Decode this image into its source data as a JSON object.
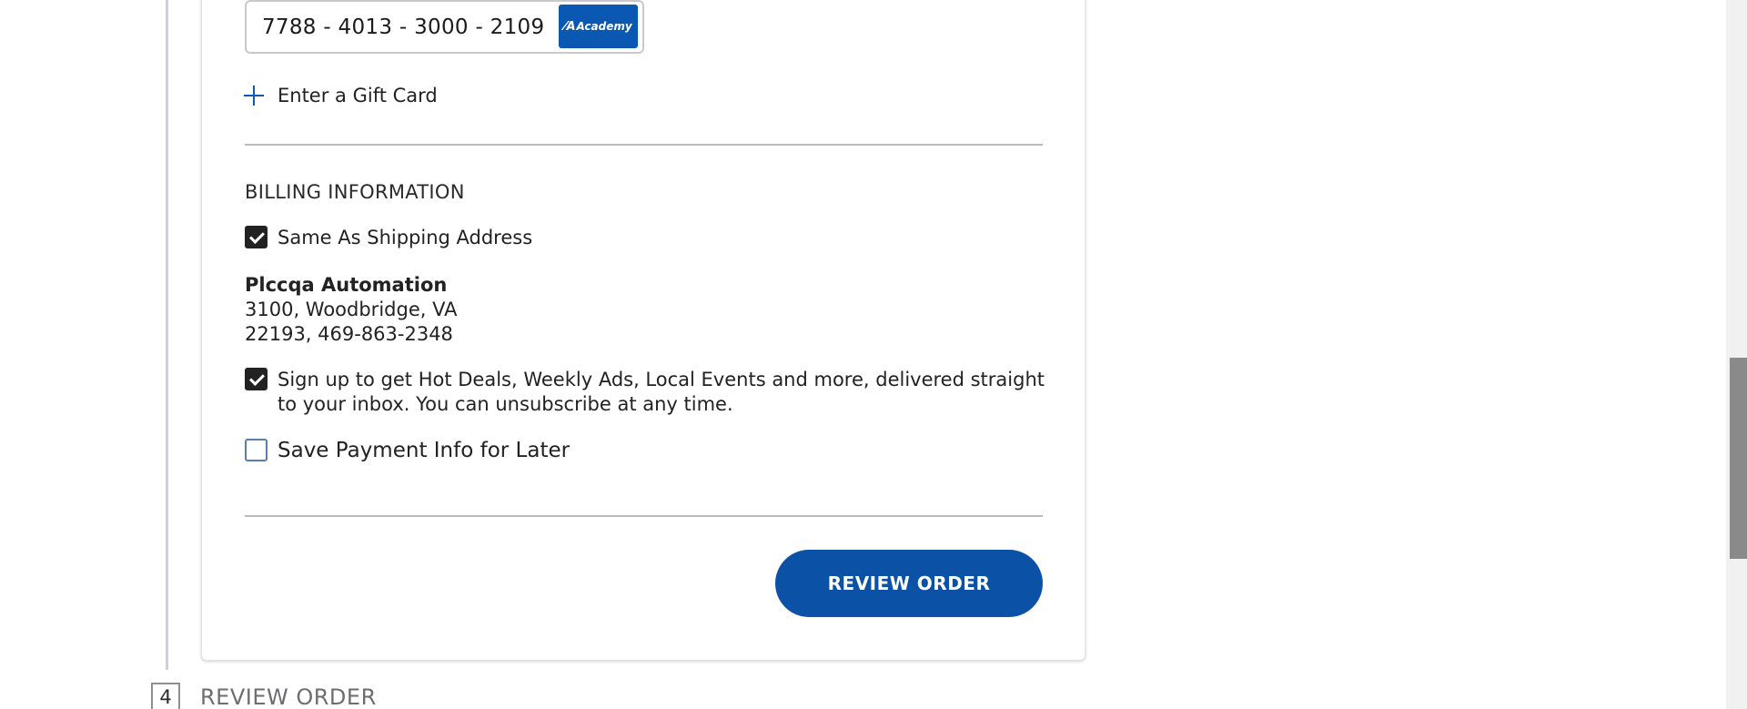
{
  "payment": {
    "saved_card_number": "7788 - 4013 - 3000 - 2109",
    "card_brand": "Academy",
    "gift_card_label": "Enter a Gift Card"
  },
  "billing": {
    "section_title": "BILLING INFORMATION",
    "same_as_shipping_label": "Same As Shipping Address",
    "same_as_shipping_checked": true,
    "address_name": "Plccqa Automation",
    "address_line1": "3100, Woodbridge, VA",
    "address_line2": "22193, 469-863-2348",
    "signup_label": "Sign up to get Hot Deals, Weekly Ads, Local Events and more, delivered straight to your inbox. You can unsubscribe at any time.",
    "signup_checked": true,
    "save_payment_label": "Save Payment Info for Later",
    "save_payment_checked": false
  },
  "actions": {
    "review_order_button": "REVIEW ORDER"
  },
  "next_step": {
    "number": "4",
    "label": "REVIEW ORDER"
  },
  "colors": {
    "accent": "#0b52a6",
    "card_brand_bg": "#0a58b1"
  }
}
